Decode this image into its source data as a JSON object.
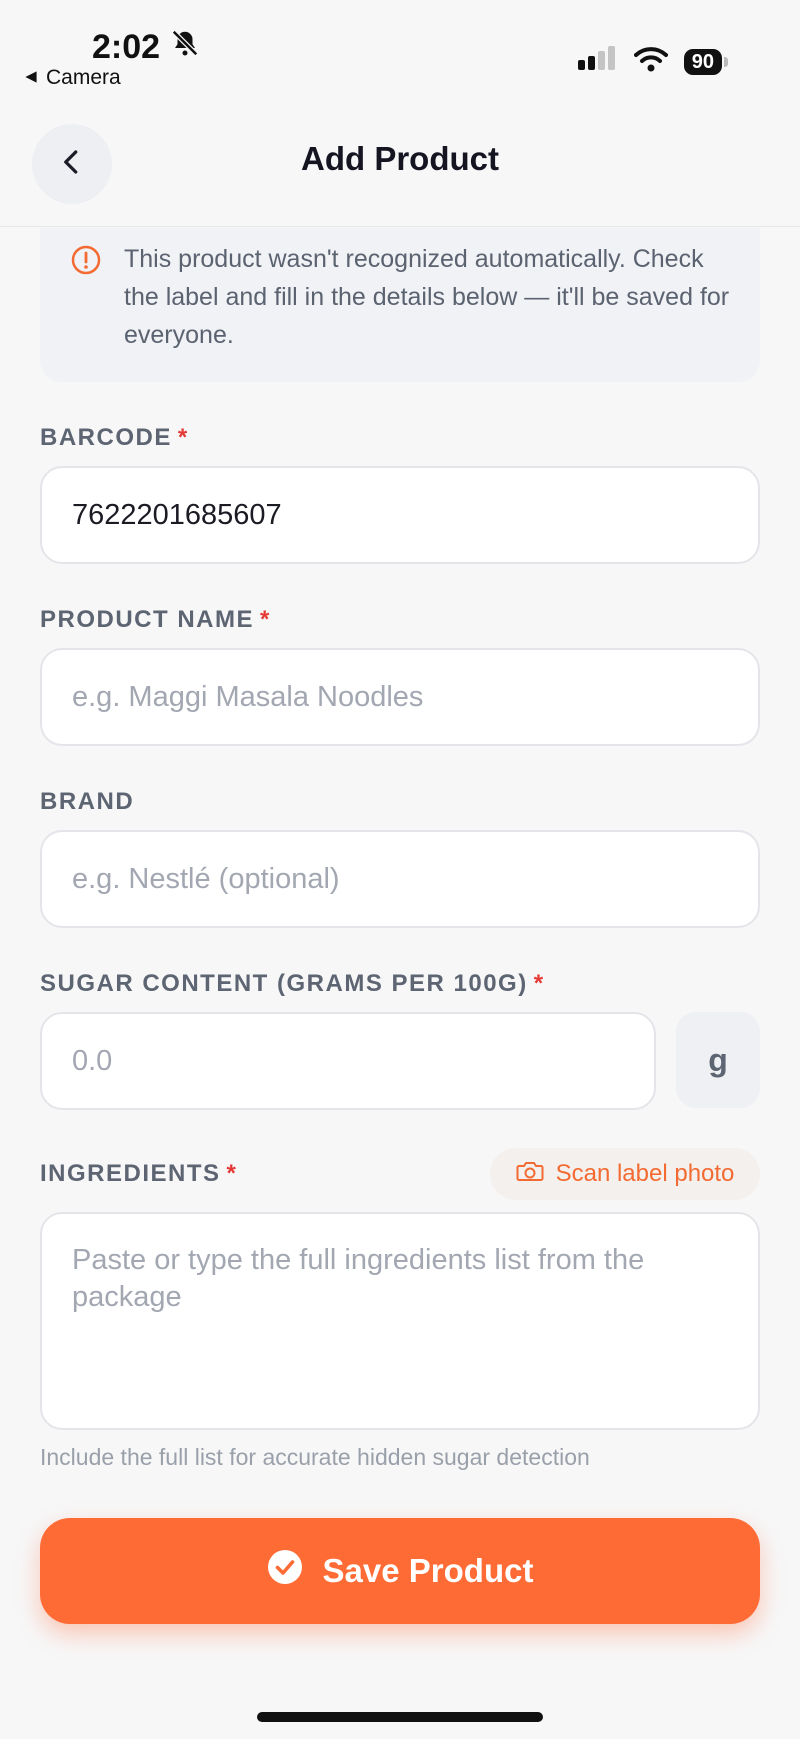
{
  "status_bar": {
    "time": "2:02",
    "back_app": "Camera",
    "battery": "90",
    "icons": [
      "bell-slash-icon",
      "signal-icon",
      "wifi-icon",
      "battery-icon"
    ]
  },
  "nav": {
    "title": "Add Product",
    "back_icon": "chevron-left-icon"
  },
  "notice": {
    "icon": "alert-circle-icon",
    "text": "This product wasn't recognized automatically. Check the label and fill in the details below — it'll be saved for everyone."
  },
  "form": {
    "barcode": {
      "label": "BARCODE",
      "required": "*",
      "value": "7622201685607"
    },
    "product_name": {
      "label": "PRODUCT NAME",
      "required": "*",
      "placeholder": "e.g. Maggi Masala Noodles"
    },
    "brand": {
      "label": "BRAND",
      "placeholder": "e.g. Nestlé (optional)"
    },
    "sugar": {
      "label": "SUGAR CONTENT (GRAMS PER 100G)",
      "required": "*",
      "placeholder": "0.0",
      "unit": "g"
    },
    "ingredients": {
      "label": "INGREDIENTS",
      "required": "*",
      "scan_label": "Scan label photo",
      "scan_icon": "camera-icon",
      "placeholder": "Paste or type the full ingredients list from the package",
      "hint": "Include the full list for accurate hidden sugar detection"
    }
  },
  "save_button": {
    "label": "Save Product",
    "icon": "check-circle-icon"
  },
  "colors": {
    "accent": "#ff6b35",
    "required": "#e53935",
    "background": "#f7f7f8"
  }
}
